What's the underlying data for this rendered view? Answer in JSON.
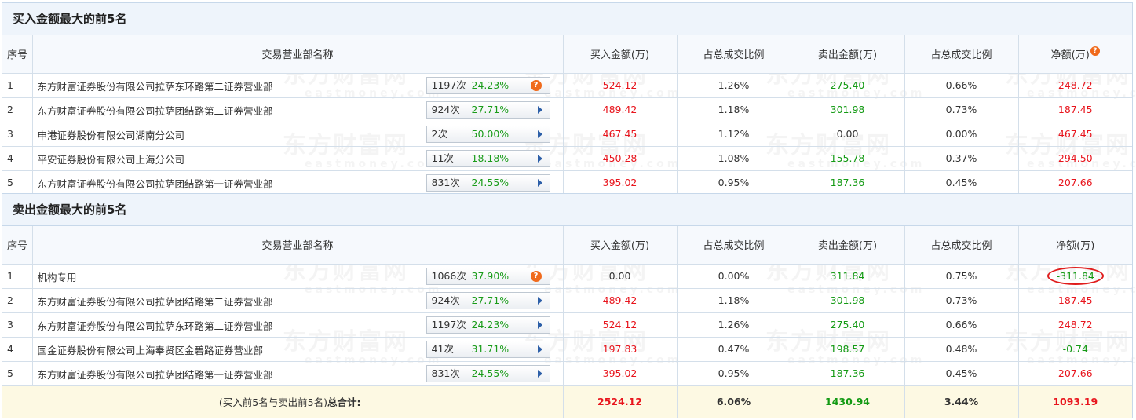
{
  "buy_section": {
    "title": "买入金额最大的前5名",
    "headers": {
      "idx": "序号",
      "name": "交易营业部名称",
      "buy": "买入金额(万)",
      "buy_ratio": "占总成交比例",
      "sell": "卖出金额(万)",
      "sell_ratio": "占总成交比例",
      "net": "净额(万)",
      "net_help_icon": "?"
    },
    "rows": [
      {
        "idx": "1",
        "name": "东方财富证券股份有限公司拉萨东环路第二证券营业部",
        "count": "1197次",
        "pct": "24.23%",
        "icon": "question-icon",
        "buy": "524.12",
        "buy_ratio": "1.26%",
        "sell": "275.40",
        "sell_ratio": "0.66%",
        "net": "248.72"
      },
      {
        "idx": "2",
        "name": "东方财富证券股份有限公司拉萨团结路第二证券营业部",
        "count": "924次",
        "pct": "27.71%",
        "icon": "arrow-right-icon",
        "buy": "489.42",
        "buy_ratio": "1.18%",
        "sell": "301.98",
        "sell_ratio": "0.73%",
        "net": "187.45"
      },
      {
        "idx": "3",
        "name": "申港证券股份有限公司湖南分公司",
        "count": "2次",
        "pct": "50.00%",
        "icon": "arrow-right-icon",
        "buy": "467.45",
        "buy_ratio": "1.12%",
        "sell": "0.00",
        "sell_ratio": "0.00%",
        "net": "467.45"
      },
      {
        "idx": "4",
        "name": "平安证券股份有限公司上海分公司",
        "count": "11次",
        "pct": "18.18%",
        "icon": "arrow-right-icon",
        "buy": "450.28",
        "buy_ratio": "1.08%",
        "sell": "155.78",
        "sell_ratio": "0.37%",
        "net": "294.50"
      },
      {
        "idx": "5",
        "name": "东方财富证券股份有限公司拉萨团结路第一证券营业部",
        "count": "831次",
        "pct": "24.55%",
        "icon": "arrow-right-icon",
        "buy": "395.02",
        "buy_ratio": "0.95%",
        "sell": "187.36",
        "sell_ratio": "0.45%",
        "net": "207.66"
      }
    ]
  },
  "sell_section": {
    "title": "卖出金额最大的前5名",
    "headers": {
      "idx": "序号",
      "name": "交易营业部名称",
      "buy": "买入金额(万)",
      "buy_ratio": "占总成交比例",
      "sell": "卖出金额(万)",
      "sell_ratio": "占总成交比例",
      "net": "净额(万)"
    },
    "rows": [
      {
        "idx": "1",
        "name": "机构专用",
        "count": "1066次",
        "pct": "37.90%",
        "icon": "question-icon",
        "buy": "0.00",
        "buy_ratio": "0.00%",
        "sell": "311.84",
        "sell_ratio": "0.75%",
        "net": "-311.84"
      },
      {
        "idx": "2",
        "name": "东方财富证券股份有限公司拉萨团结路第二证券营业部",
        "count": "924次",
        "pct": "27.71%",
        "icon": "arrow-right-icon",
        "buy": "489.42",
        "buy_ratio": "1.18%",
        "sell": "301.98",
        "sell_ratio": "0.73%",
        "net": "187.45"
      },
      {
        "idx": "3",
        "name": "东方财富证券股份有限公司拉萨东环路第二证券营业部",
        "count": "1197次",
        "pct": "24.23%",
        "icon": "arrow-right-icon",
        "buy": "524.12",
        "buy_ratio": "1.26%",
        "sell": "275.40",
        "sell_ratio": "0.66%",
        "net": "248.72"
      },
      {
        "idx": "4",
        "name": "国金证券股份有限公司上海奉贤区金碧路证券营业部",
        "count": "41次",
        "pct": "31.71%",
        "icon": "arrow-right-icon",
        "buy": "197.83",
        "buy_ratio": "0.47%",
        "sell": "198.57",
        "sell_ratio": "0.48%",
        "net": "-0.74"
      },
      {
        "idx": "5",
        "name": "东方财富证券股份有限公司拉萨团结路第一证券营业部",
        "count": "831次",
        "pct": "24.55%",
        "icon": "arrow-right-icon",
        "buy": "395.02",
        "buy_ratio": "0.95%",
        "sell": "187.36",
        "sell_ratio": "0.45%",
        "net": "207.66"
      }
    ]
  },
  "totals": {
    "label_prefix": "(买入前5名与卖出前5名)",
    "label_bold": "总合计:",
    "buy": "2524.12",
    "buy_ratio": "6.06%",
    "sell": "1430.94",
    "sell_ratio": "3.44%",
    "net": "1093.19"
  },
  "watermark": {
    "cn": "东方财富网",
    "en": "eastmoney.com"
  },
  "colors": {
    "positive": "#e8151d",
    "negative": "#139a13",
    "header_bg": "#eef4fb",
    "total_bg": "#fdf9e3",
    "annotation_circle": "#e01c1c"
  }
}
